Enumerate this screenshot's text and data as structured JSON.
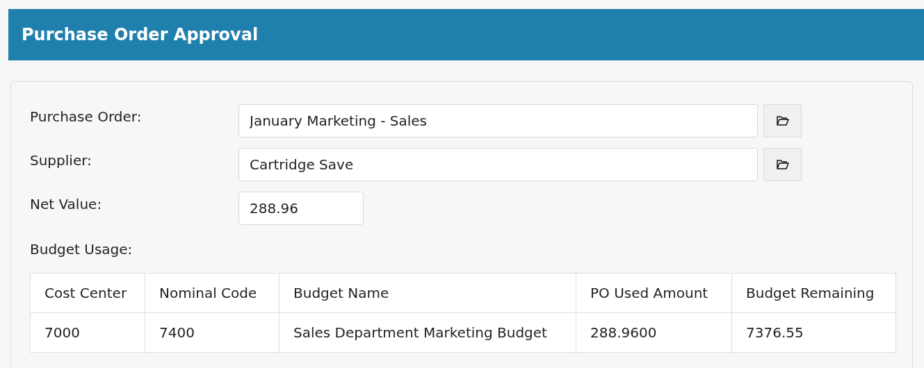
{
  "header": {
    "title": "Purchase Order Approval"
  },
  "fields": [
    {
      "label": "Purchase Order:",
      "value": "January Marketing - Sales",
      "kind": "lookup"
    },
    {
      "label": "Supplier:",
      "value": "Cartridge Save",
      "kind": "lookup"
    },
    {
      "label": "Net Value:",
      "value": "288.96",
      "kind": "short"
    }
  ],
  "budget_usage": {
    "label": "Budget Usage:",
    "table": {
      "columns": [
        "Cost Center",
        "Nominal Code",
        "Budget Name",
        "PO Used Amount",
        "Budget Remaining"
      ],
      "rows": [
        [
          "7000",
          "7400",
          "Sales Department Marketing Budget",
          "288.9600",
          "7376.55"
        ]
      ]
    }
  }
}
